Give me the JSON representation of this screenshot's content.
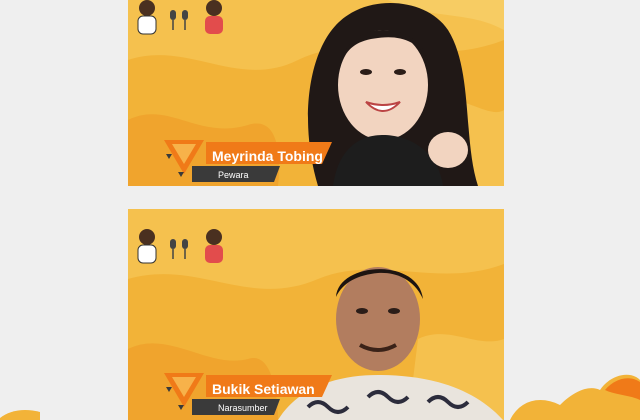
{
  "participants": [
    {
      "name": "Meyrinda Tobing",
      "role": "Pewara"
    },
    {
      "name": "Bukik Setiawan",
      "role": "Narasumber"
    }
  ],
  "colors": {
    "tile_background": "#f2b338",
    "accent_orange": "#f07a18",
    "accent_dark": "#3a3a3a",
    "page_background": "#efefef"
  },
  "icons": [
    "podcast-hosts-icon",
    "microphone-icon"
  ]
}
